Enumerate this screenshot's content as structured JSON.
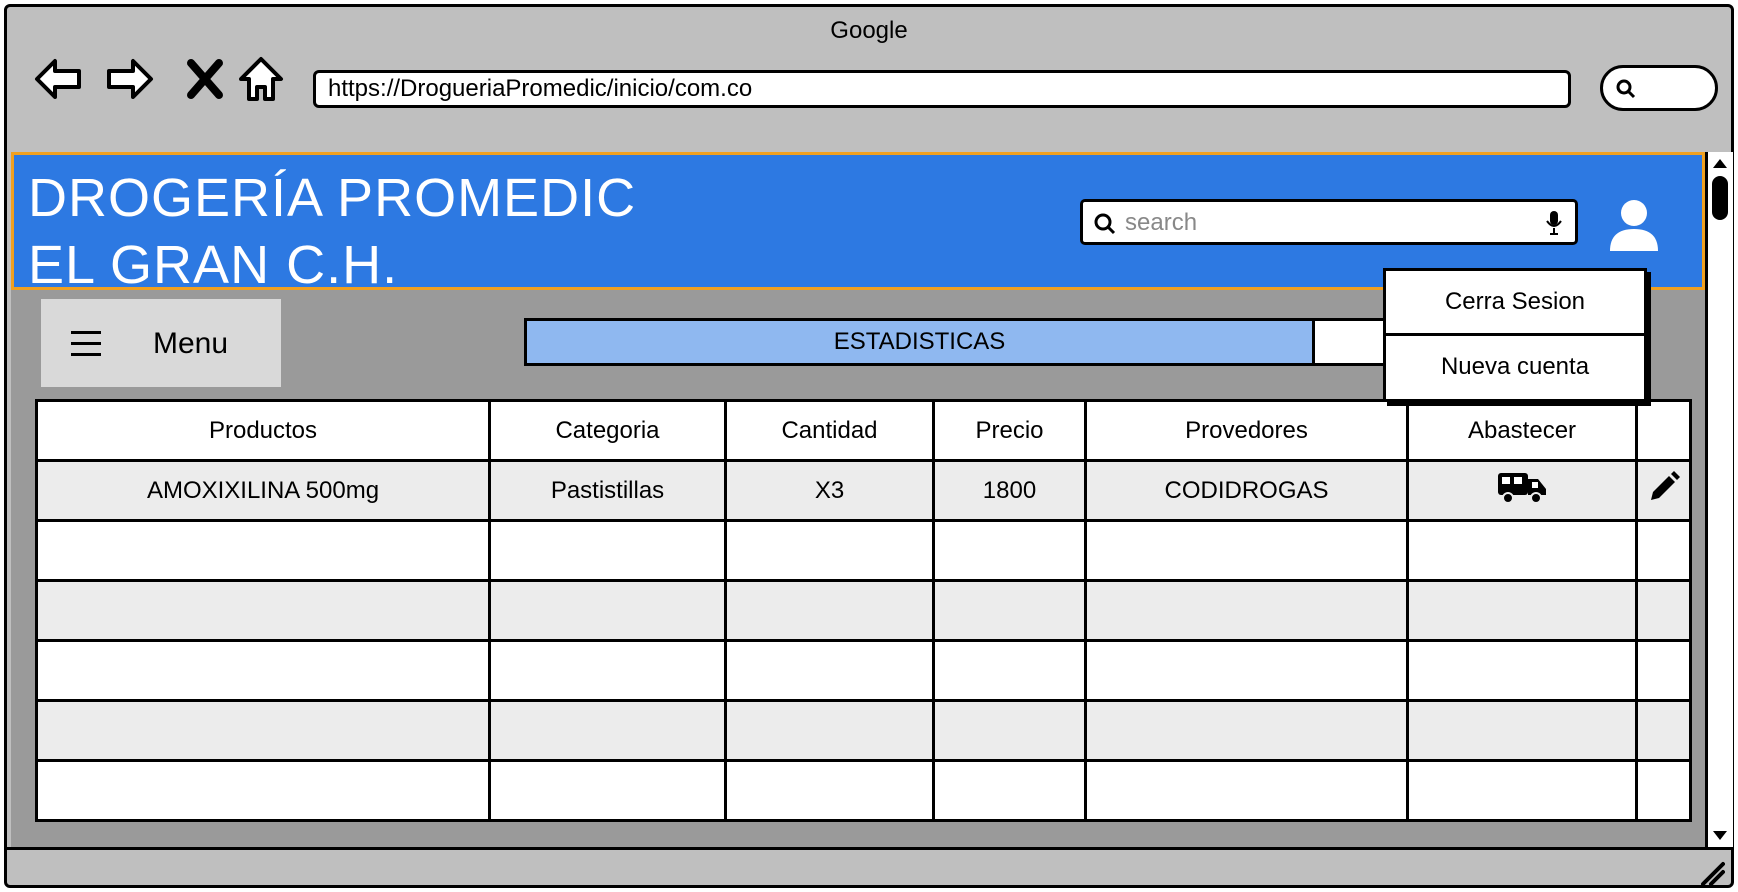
{
  "browser": {
    "title": "Google",
    "url": "https://DrogueriaPromedic/inicio/com.co"
  },
  "header": {
    "brand_line1": "DROGERÍA PROMEDIC",
    "brand_line2": "EL GRAN C.H.",
    "search_placeholder": "search",
    "bg_color": "#2d79e2",
    "border_color": "#f0a020"
  },
  "menu": {
    "label": "Menu"
  },
  "tabs": {
    "active_label": "ESTADISTICAS"
  },
  "user_menu": {
    "items": [
      {
        "label": "Cerra Sesion"
      },
      {
        "label": "Nueva cuenta"
      }
    ]
  },
  "table": {
    "columns": [
      "Productos",
      "Categoria",
      "Cantidad",
      "Precio",
      "Provedores",
      "Abastecer",
      ""
    ],
    "rows": [
      {
        "producto": "AMOXIXILINA 500mg",
        "categoria": "Pastistillas",
        "cantidad": "X3",
        "precio": "1800",
        "proveedor": "CODIDROGAS",
        "abastecer_icon": "truck-icon",
        "edit_icon": "pencil-icon"
      }
    ]
  }
}
